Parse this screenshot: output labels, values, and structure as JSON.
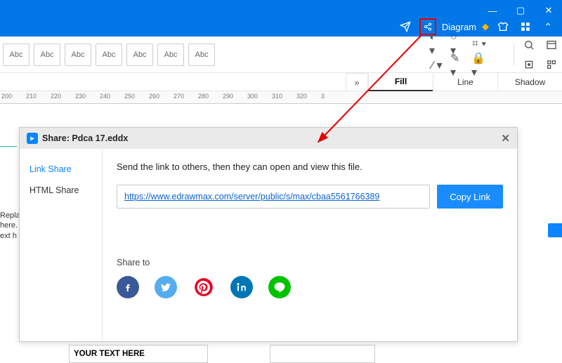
{
  "titlebar": {
    "diagram_label": "Diagram"
  },
  "toolbar": {
    "abc_items": [
      "Abc",
      "Abc",
      "Abc",
      "Abc",
      "Abc",
      "Abc",
      "Abc"
    ]
  },
  "tabs": {
    "fill": "Fill",
    "line": "Line",
    "shadow": "Shadow"
  },
  "ruler": {
    "marks": [
      "200",
      "210",
      "220",
      "230",
      "240",
      "250",
      "260",
      "270",
      "280",
      "290",
      "300",
      "310",
      "320",
      "3"
    ]
  },
  "canvas": {
    "stub_lines": [
      "Repla",
      "here.",
      "ext h"
    ],
    "your_text": "YOUR TEXT HERE"
  },
  "dialog": {
    "title": "Share: Pdca 17.eddx",
    "side": {
      "link_share": "Link Share",
      "html_share": "HTML Share"
    },
    "main": {
      "instructions": "Send the link to others, then they can open and view this file.",
      "url": "https://www.edrawmax.com/server/public/s/max/cbaa5561766389",
      "copy_btn": "Copy Link",
      "share_to": "Share to"
    }
  }
}
